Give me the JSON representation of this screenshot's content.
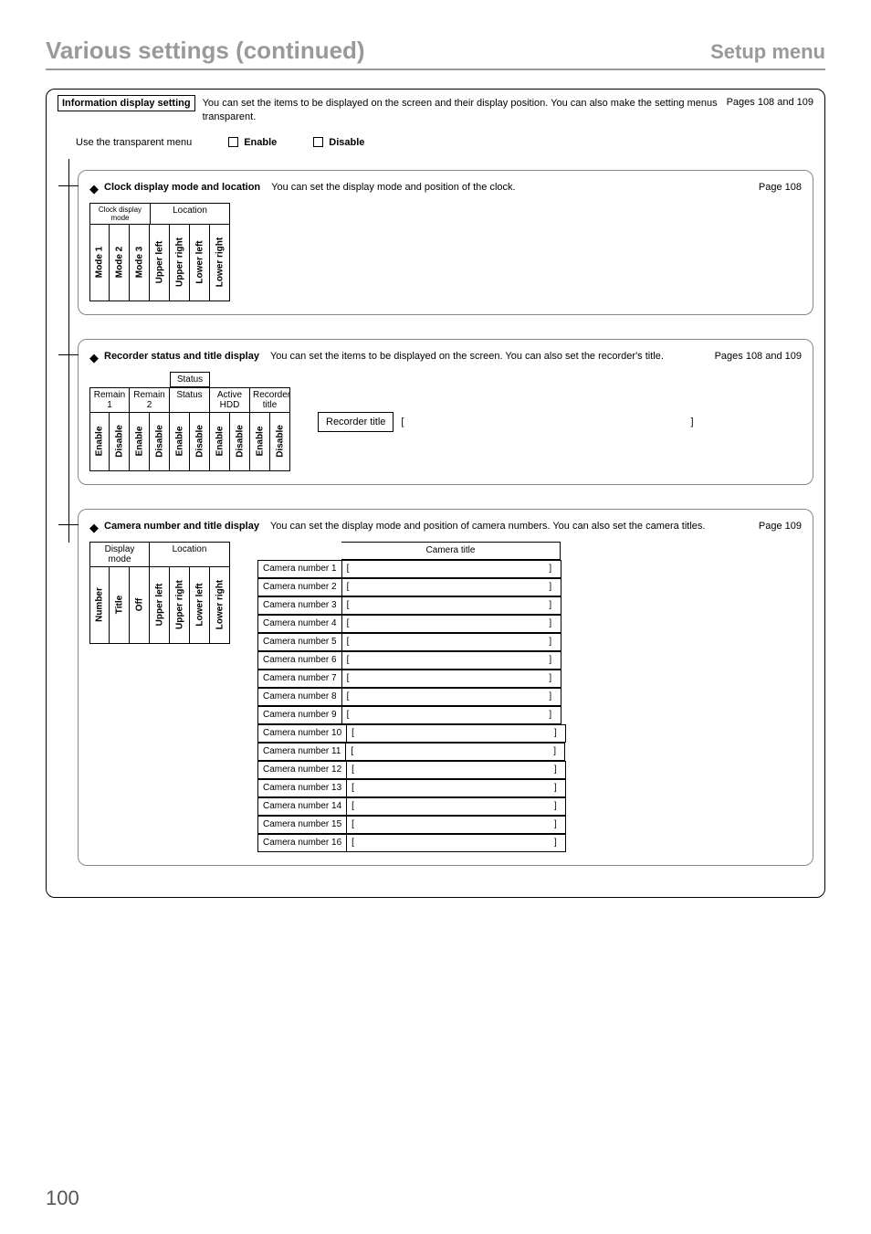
{
  "page": {
    "title": "Various settings (continued)",
    "section": "Setup menu",
    "number": "100"
  },
  "outer": {
    "label": "Information display setting",
    "desc": "You can set the items to be displayed on the screen and their display position. You can also make the setting menus transparent.",
    "pageref": "Pages 108 and 109",
    "transparent_label": "Use the transparent menu",
    "enable": "Enable",
    "disable": "Disable"
  },
  "clock": {
    "heading": "Clock display mode and location",
    "desc": "You can set the display mode and position of the clock.",
    "pageref": "Page 108",
    "group1": "Clock display mode",
    "group2": "Location",
    "cols": [
      "Mode 1",
      "Mode 2",
      "Mode 3",
      "Upper left",
      "Upper right",
      "Lower left",
      "Lower right"
    ]
  },
  "recorder": {
    "heading": "Recorder status and title display",
    "desc": "You can set the items to be displayed on the screen. You can also set the recorder's title.",
    "pageref": "Pages 108 and 109",
    "status_group": "Status",
    "headers": [
      "Remain 1",
      "Remain 2",
      "Status",
      "Active HDD",
      "Recorder title"
    ],
    "toggle_cols": [
      "Enable",
      "Disable",
      "Enable",
      "Disable",
      "Enable",
      "Disable",
      "Enable",
      "Disable",
      "Enable",
      "Disable"
    ],
    "title_label": "Recorder title",
    "title_value": ""
  },
  "camera": {
    "heading": "Camera number and title display",
    "desc": "You can set the display mode and position of camera numbers. You can also set the camera titles.",
    "pageref": "Page 109",
    "group1": "Display mode",
    "group2": "Location",
    "cols": [
      "Number",
      "Title",
      "Off",
      "Upper left",
      "Upper right",
      "Lower left",
      "Lower right"
    ],
    "title_head": "Camera title",
    "rows": [
      "Camera number 1",
      "Camera number 2",
      "Camera number 3",
      "Camera number 4",
      "Camera number 5",
      "Camera number 6",
      "Camera number 7",
      "Camera number 8",
      "Camera number 9",
      "Camera number 10",
      "Camera number 11",
      "Camera number 12",
      "Camera number 13",
      "Camera number 14",
      "Camera number 15",
      "Camera number 16"
    ]
  }
}
